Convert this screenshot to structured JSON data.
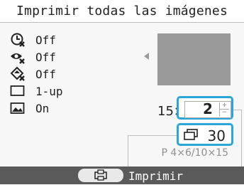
{
  "header": {
    "title": "Imprimir todas las imágenes"
  },
  "settings": {
    "items": [
      {
        "icon": "date-stamp-icon",
        "value": "Off"
      },
      {
        "icon": "red-eye-correction-icon",
        "value": "Off"
      },
      {
        "icon": "auto-correction-icon",
        "value": "Off"
      },
      {
        "icon": "layout-frame-icon",
        "value": "1-up"
      },
      {
        "icon": "border-photo-icon",
        "value": "On"
      }
    ]
  },
  "quantity": {
    "prefix": "15×",
    "copies": "2",
    "plus": "+",
    "minus": "−"
  },
  "total": {
    "icon": "copies-stack-icon",
    "count": "30"
  },
  "paper": {
    "label": "P 4×6/10×15"
  },
  "footer": {
    "print_label": "Imprimir",
    "print_icon": "print-icon"
  },
  "colors": {
    "accent": "#2aa6d8",
    "footer": "#5a5a5a",
    "preview": "#9a9a9a"
  }
}
